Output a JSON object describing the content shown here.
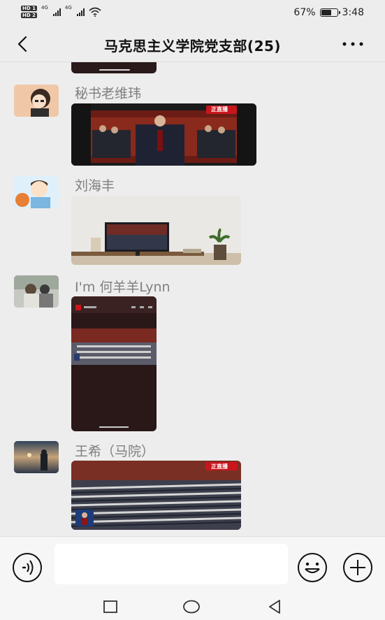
{
  "status_bar": {
    "hd1": "HD 1",
    "hd2": "HD 2",
    "net1": "4G",
    "net2": "4G",
    "battery_percent": "67%",
    "battery_level": 0.67,
    "time": "3:48"
  },
  "header": {
    "title": "马克思主义学院党支部(25)",
    "back_icon": "chevron-left-icon",
    "more_icon": "more-dots-icon"
  },
  "messages": [
    {
      "sender": "",
      "media": "video"
    },
    {
      "sender": "秘书老维玮",
      "media": "image",
      "overlay": "正直播"
    },
    {
      "sender": "刘海丰",
      "media": "image"
    },
    {
      "sender": "I'm 何羊羊Lynn",
      "media": "screenshot"
    },
    {
      "sender": "王希（马院）",
      "media": "image",
      "overlay": "正直播"
    }
  ],
  "input_bar": {
    "voice_icon": "voice-icon",
    "emoji_icon": "emoji-icon",
    "plus_icon": "plus-icon",
    "placeholder": ""
  },
  "nav_bar": {
    "recent_icon": "square-recent-icon",
    "home_icon": "circle-home-icon",
    "back_icon": "triangle-back-icon"
  },
  "colors": {
    "background": "#ededed",
    "sender_text": "#7f7f7f",
    "live_badge": "#c8161d"
  }
}
